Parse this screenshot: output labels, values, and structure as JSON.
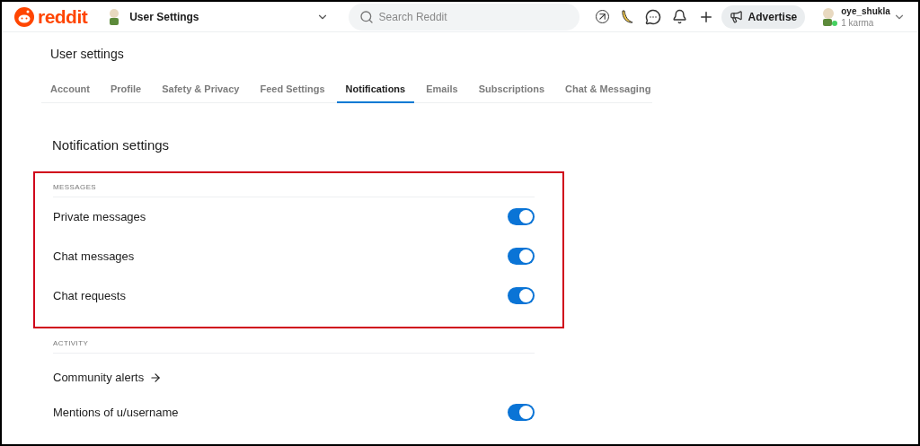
{
  "header": {
    "logo": "reddit",
    "community": "User Settings",
    "search": {
      "placeholder": "Search Reddit"
    },
    "advertise": "Advertise",
    "user": {
      "name": "oye_shukla",
      "karma": "1 karma"
    }
  },
  "page_title": "User settings",
  "tabs": [
    {
      "label": "Account",
      "selected": false
    },
    {
      "label": "Profile",
      "selected": false
    },
    {
      "label": "Safety & Privacy",
      "selected": false
    },
    {
      "label": "Feed Settings",
      "selected": false
    },
    {
      "label": "Notifications",
      "selected": true
    },
    {
      "label": "Emails",
      "selected": false
    },
    {
      "label": "Subscriptions",
      "selected": false
    },
    {
      "label": "Chat & Messaging",
      "selected": false
    }
  ],
  "heading": "Notification settings",
  "sections": [
    {
      "title": "MESSAGES",
      "highlighted": true,
      "items": [
        {
          "kind": "toggle",
          "label": "Private messages",
          "on": true
        },
        {
          "kind": "toggle",
          "label": "Chat messages",
          "on": true
        },
        {
          "kind": "toggle",
          "label": "Chat requests",
          "on": true
        }
      ]
    },
    {
      "title": "ACTIVITY",
      "highlighted": false,
      "items": [
        {
          "kind": "link",
          "label": "Community alerts"
        },
        {
          "kind": "toggle",
          "label": "Mentions of u/username",
          "on": true
        }
      ]
    }
  ]
}
